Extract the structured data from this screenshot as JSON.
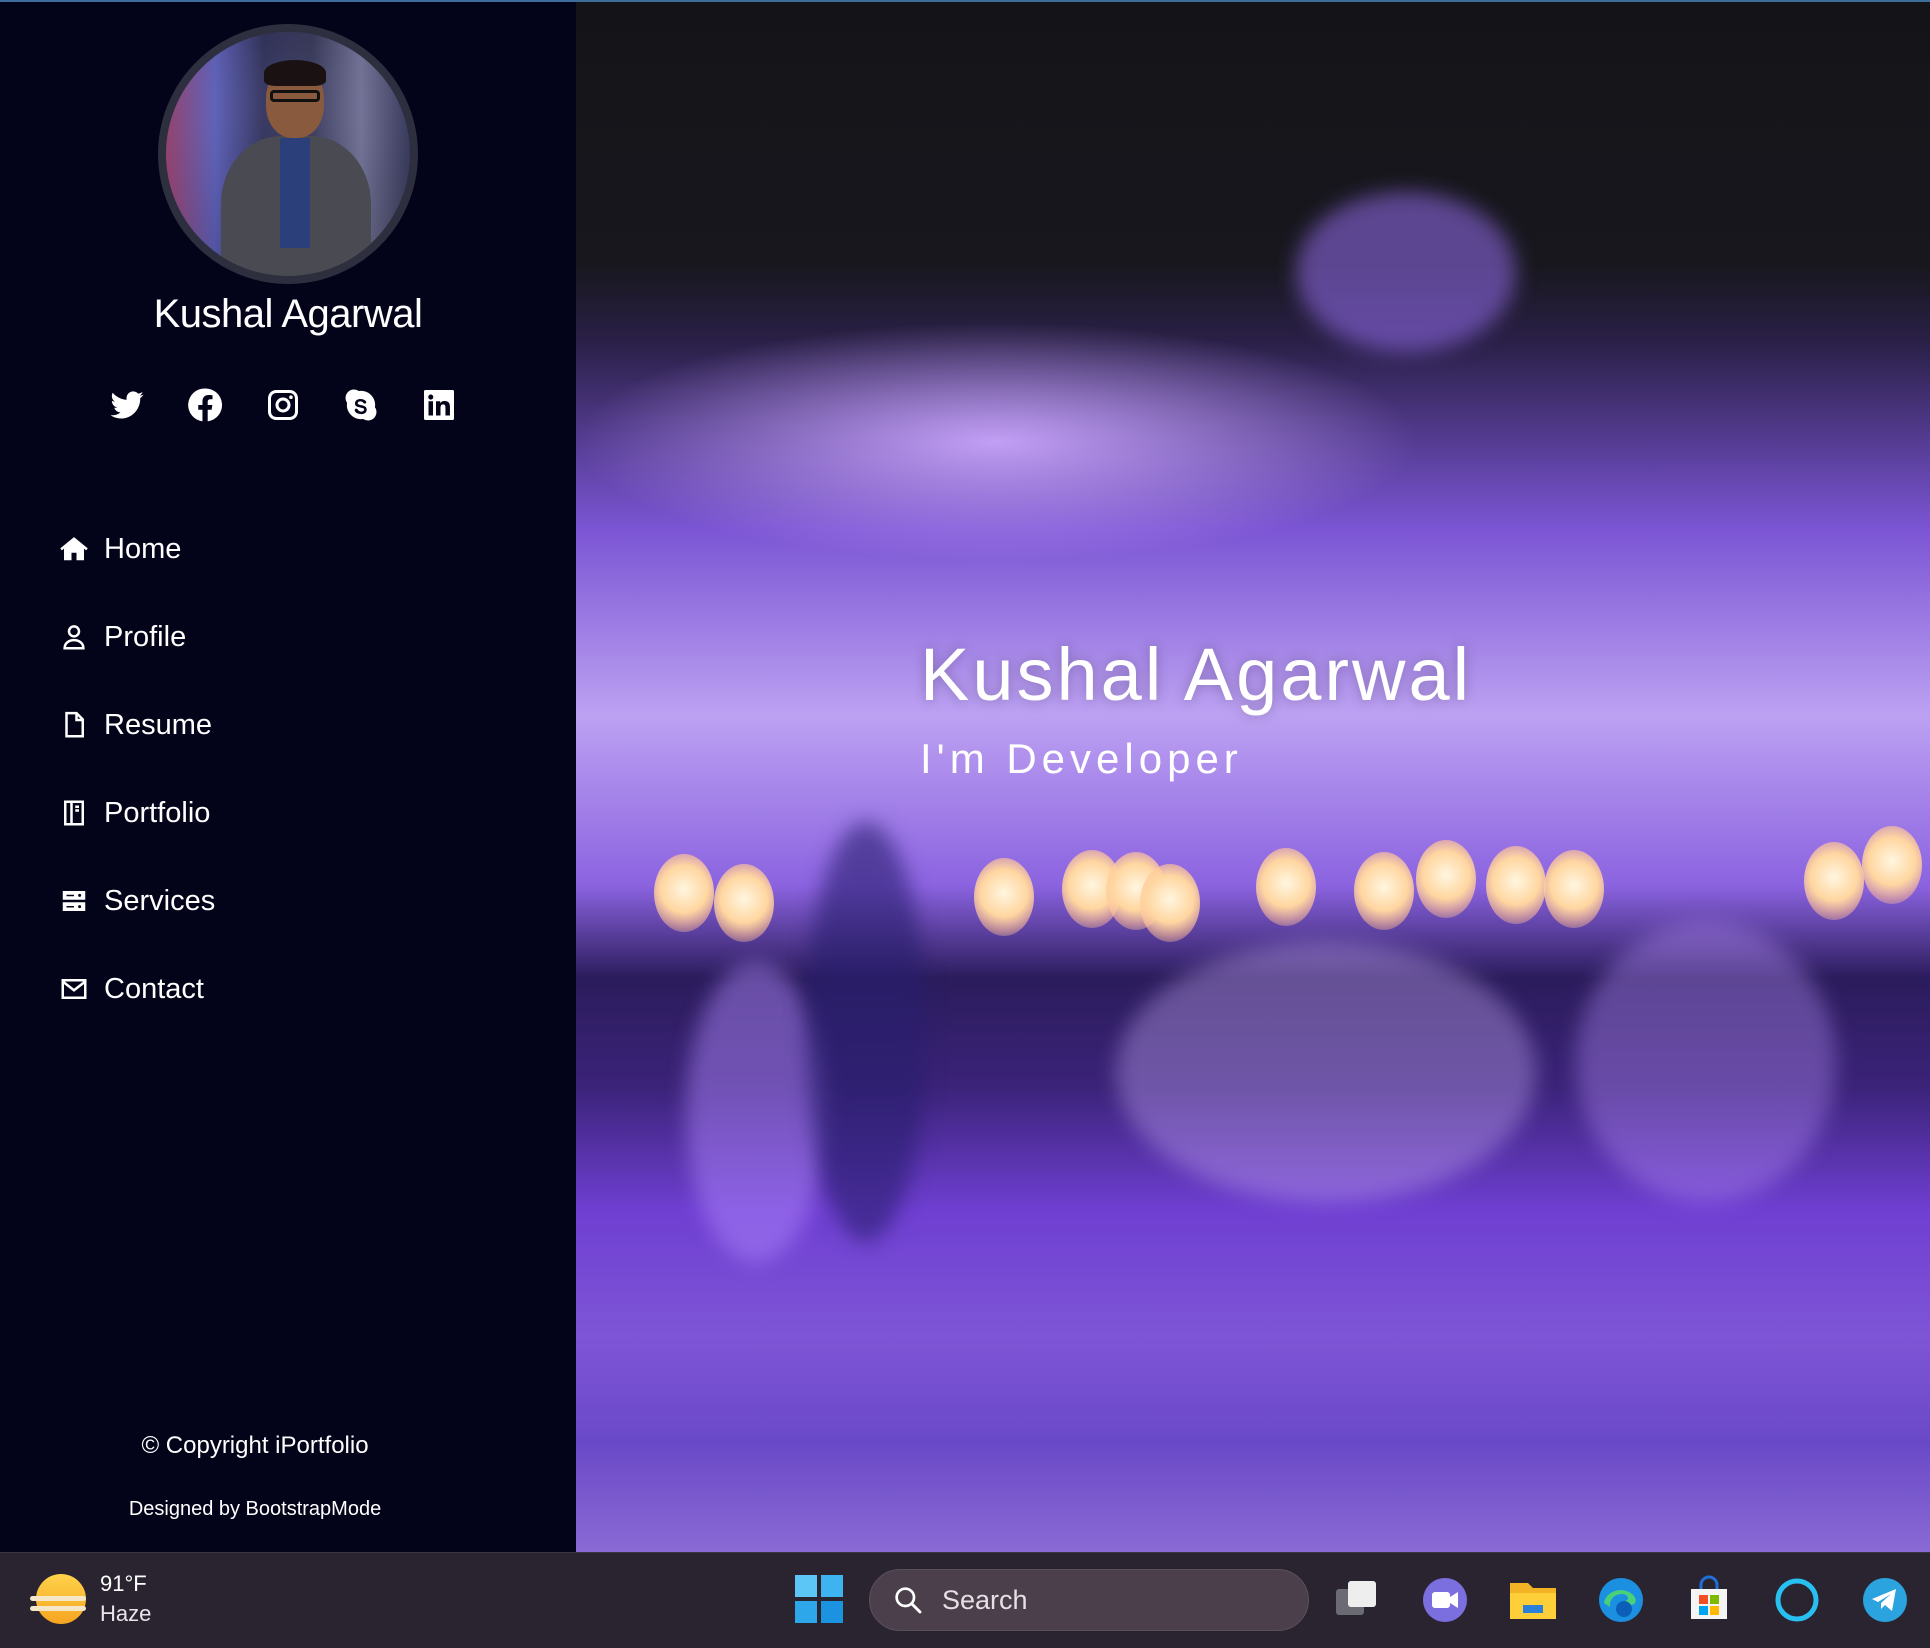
{
  "sidebar": {
    "profile_name": "Kushal Agarwal",
    "social_icons": [
      "twitter-icon",
      "facebook-icon",
      "instagram-icon",
      "skype-icon",
      "linkedin-icon"
    ],
    "nav": [
      {
        "label": "Home",
        "icon": "home-icon"
      },
      {
        "label": "Profile",
        "icon": "user-icon"
      },
      {
        "label": "Resume",
        "icon": "file-icon"
      },
      {
        "label": "Portfolio",
        "icon": "book-icon"
      },
      {
        "label": "Services",
        "icon": "server-icon"
      },
      {
        "label": "Contact",
        "icon": "envelope-icon"
      }
    ],
    "copyright": "© Copyright iPortfolio",
    "credits": "Designed by BootstrapMode"
  },
  "hero": {
    "title": "Kushal Agarwal",
    "subtitle": "I'm Developer"
  },
  "taskbar": {
    "weather_temp": "91°F",
    "weather_condition": "Haze",
    "search_placeholder": "Search",
    "apps": [
      "task-view-icon",
      "meet-icon",
      "file-explorer-icon",
      "edge-icon",
      "store-icon",
      "cortana-icon",
      "telegram-icon"
    ]
  },
  "colors": {
    "sidebar_bg": "#03031a",
    "accent_border": "#3d6d9a",
    "taskbar_bg": "#2a2430"
  }
}
